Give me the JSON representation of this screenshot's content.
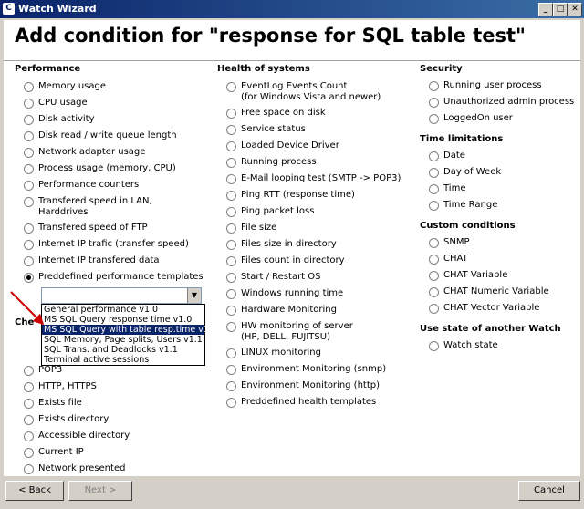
{
  "window": {
    "title": "Watch Wizard",
    "minimize": "_",
    "maximize": "□",
    "close": "✕"
  },
  "heading": "Add condition for \"response for SQL table test\"",
  "performance": {
    "title": "Performance",
    "items": [
      "Memory usage",
      "CPU usage",
      "Disk activity",
      "Disk read / write queue length",
      "Network adapter usage",
      "Process usage (memory, CPU)",
      "Performance counters",
      "Transfered speed in LAN,|Harddrives",
      "Transfered speed of FTP",
      "Internet IP trafic (transfer speed)",
      "Internet IP transfered data",
      "Preddefined performance templates"
    ],
    "selected_index": 11
  },
  "dropdown": {
    "value": "",
    "options": [
      "General performance v1.0",
      "MS SQL Query response time v1.0",
      "MS SQL Query with table resp.time v1.0",
      "SQL Memory, Page splits, Users v1.1",
      "SQL Trans. and Deadlocks v1.1",
      "Terminal active sessions"
    ],
    "highlighted_index": 2
  },
  "checks": {
    "title_partial": "Che",
    "items": [
      "POP3",
      "HTTP, HTTPS",
      "Exists file",
      "Exists directory",
      "Accessible directory",
      "Current IP",
      "Network presented"
    ]
  },
  "health": {
    "title": "Health of systems",
    "items": [
      "EventLog Events Count|(for Windows Vista and newer)",
      "Free space on disk",
      "Service status",
      "Loaded Device Driver",
      "Running process",
      "E-Mail looping test (SMTP -> POP3)",
      "Ping RTT (response time)",
      "Ping packet loss",
      "File size",
      "Files size in directory",
      "Files count in directory",
      "Start / Restart OS",
      "Windows running time",
      "Hardware Monitoring",
      "HW monitoring of server|(HP, DELL, FUJITSU)",
      "LINUX monitoring",
      "Environment Monitoring (snmp)",
      "Environment Monitoring (http)",
      "Preddefined health templates"
    ]
  },
  "security": {
    "title": "Security",
    "items": [
      "Running user process",
      "Unauthorized admin process",
      "LoggedOn user"
    ]
  },
  "time_limitations": {
    "title": "Time limitations",
    "items": [
      "Date",
      "Day of Week",
      "Time",
      "Time Range"
    ]
  },
  "custom_conditions": {
    "title": "Custom conditions",
    "items": [
      "SNMP",
      "CHAT",
      "CHAT Variable",
      "CHAT Numeric Variable",
      "CHAT Vector Variable"
    ]
  },
  "use_state": {
    "title": "Use state of another Watch",
    "items": [
      "Watch state"
    ]
  },
  "buttons": {
    "back": "< Back",
    "next": "Next >",
    "cancel": "Cancel"
  },
  "colors": {
    "titlebar": "#0a246a",
    "selection": "#0a246a",
    "arrow": "#cc0000"
  }
}
